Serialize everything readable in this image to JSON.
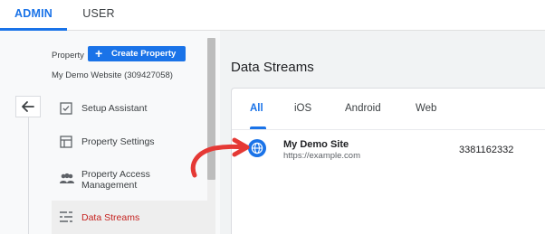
{
  "top_tabs": {
    "admin": "ADMIN",
    "user": "USER"
  },
  "sidebar": {
    "property_label": "Property",
    "create_button": "Create Property",
    "site_name": "My Demo Website (309427058)",
    "items": [
      {
        "label": "Setup Assistant",
        "icon": "checklist-icon"
      },
      {
        "label": "Property Settings",
        "icon": "layout-icon"
      },
      {
        "label": "Property Access Management",
        "icon": "people-icon"
      },
      {
        "label": "Data Streams",
        "icon": "streams-icon",
        "active": true
      }
    ]
  },
  "main": {
    "title": "Data Streams",
    "tabs": [
      "All",
      "iOS",
      "Android",
      "Web"
    ],
    "active_tab": "All",
    "stream": {
      "name": "My Demo Site",
      "url": "https://example.com",
      "id": "3381162332",
      "icon": "globe-icon"
    }
  },
  "colors": {
    "accent": "#1a73e8",
    "active_nav": "#c5221f",
    "annotation_arrow": "#e53935"
  }
}
